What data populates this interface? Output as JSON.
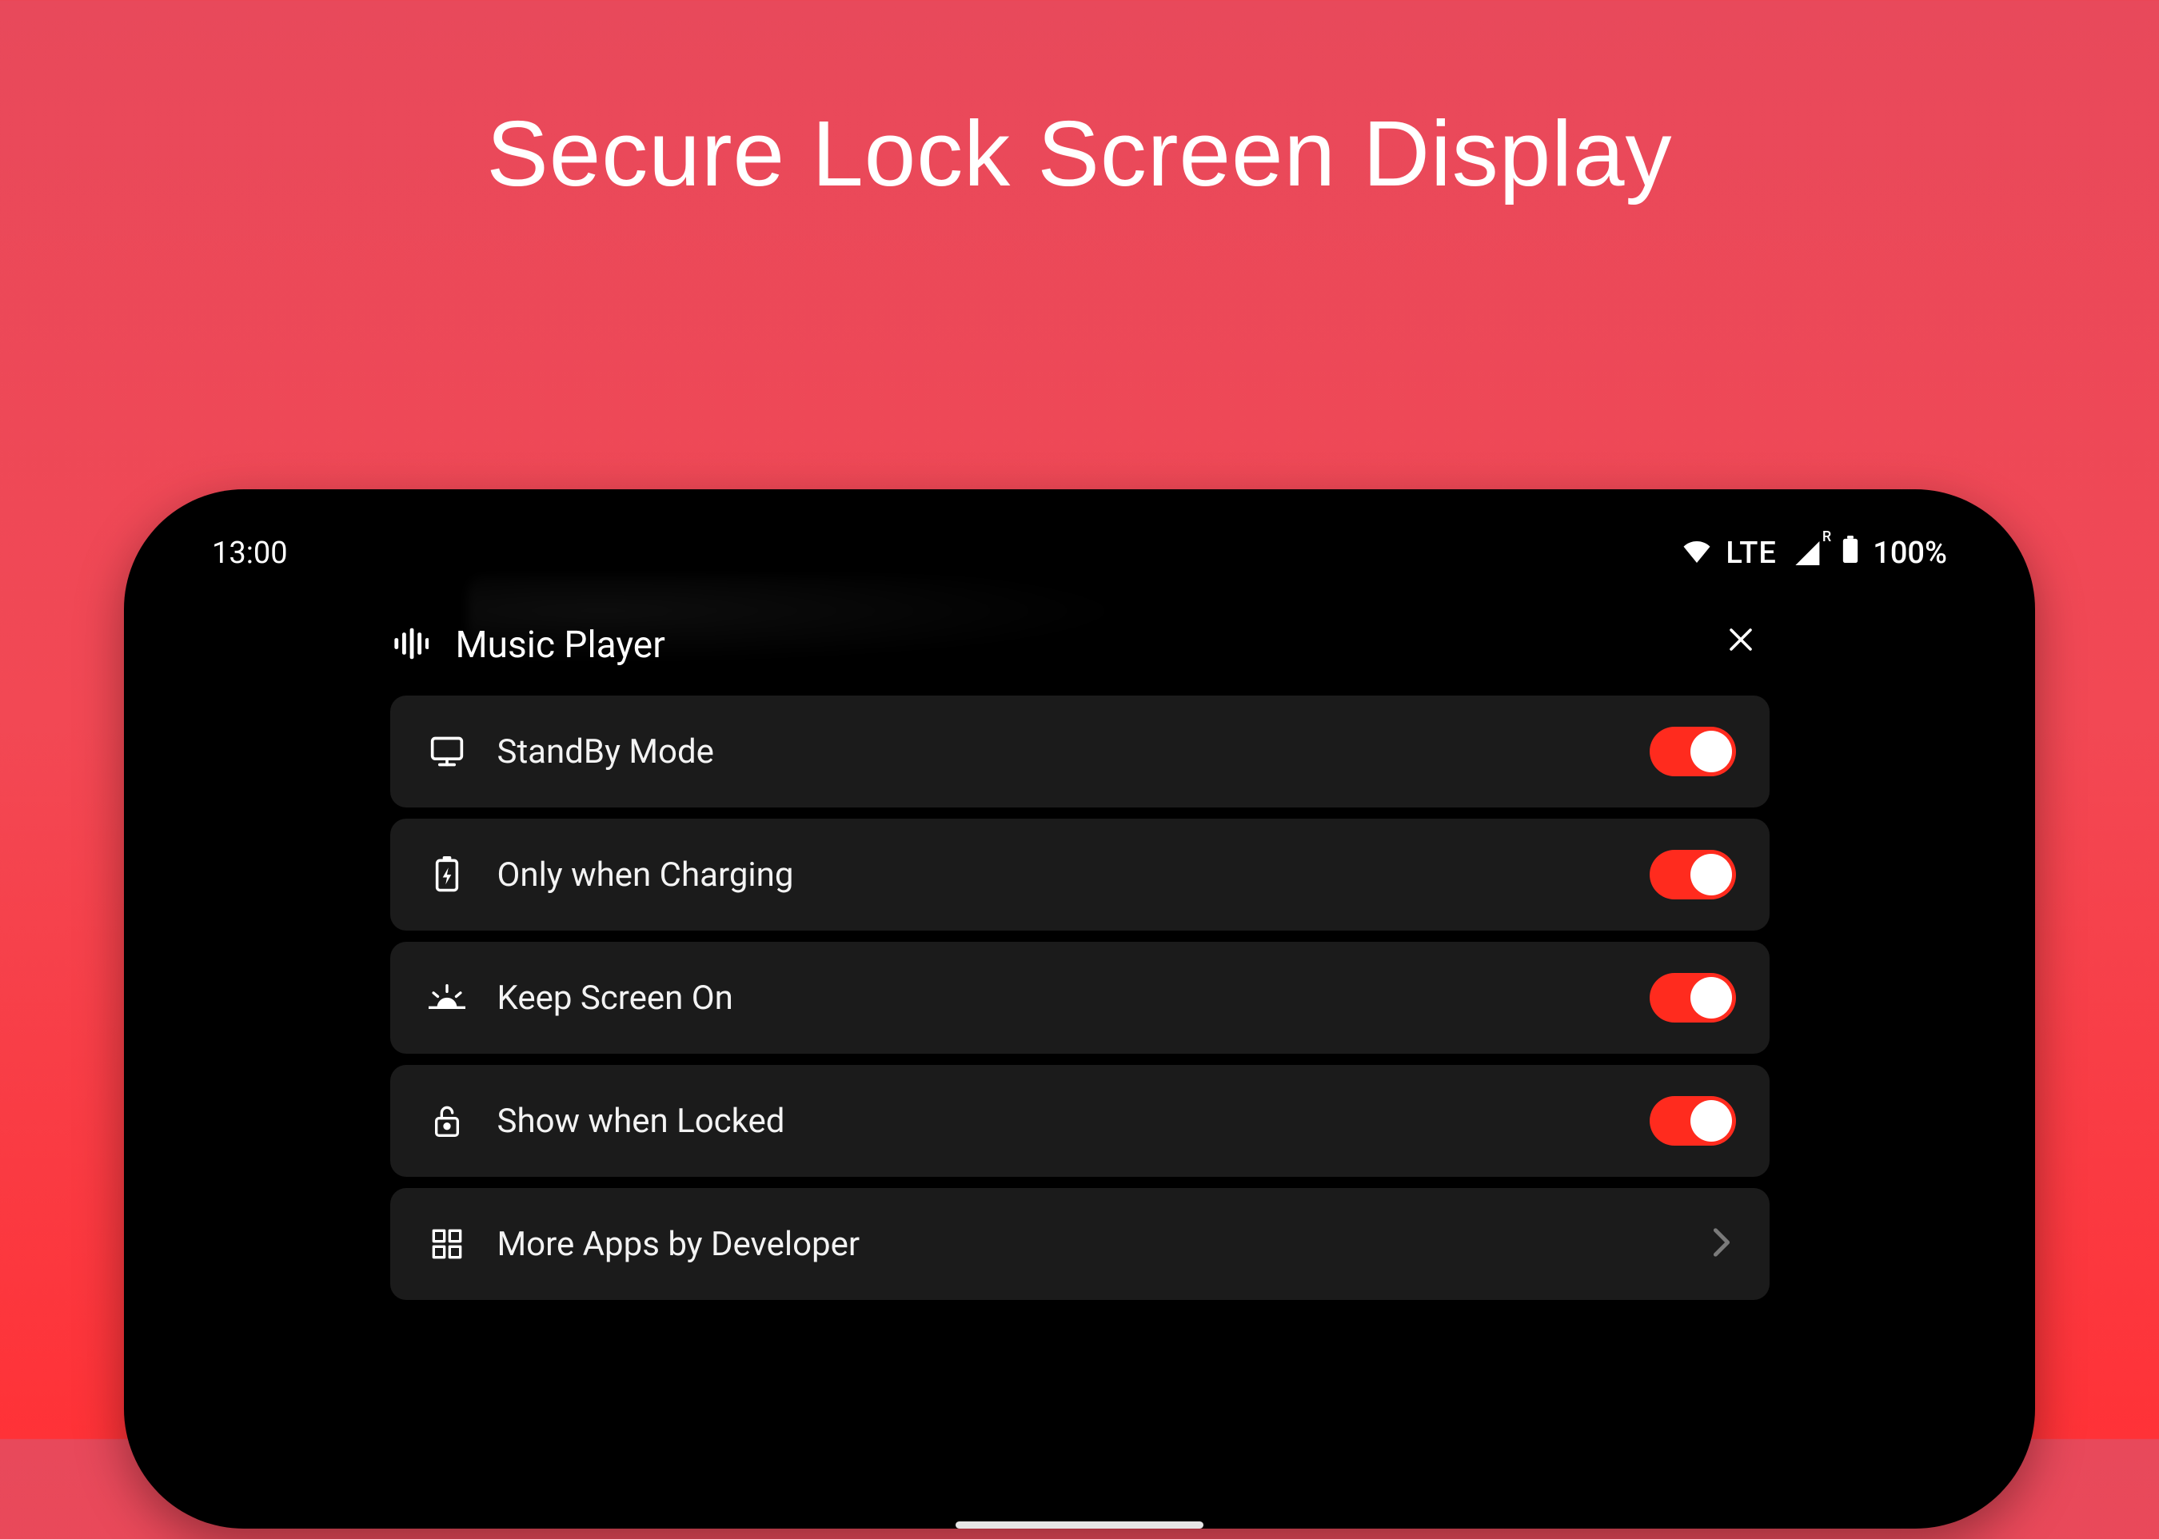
{
  "promo": {
    "title": "Secure Lock Screen Display"
  },
  "statusbar": {
    "time": "13:00",
    "network": "LTE",
    "roaming": "R",
    "battery": "100%"
  },
  "app": {
    "title": "Music Player"
  },
  "settings": [
    {
      "icon": "monitor-icon",
      "label": "StandBy Mode",
      "toggle": true
    },
    {
      "icon": "battery-charging-icon",
      "label": "Only when Charging",
      "toggle": true
    },
    {
      "icon": "brightness-icon",
      "label": "Keep Screen On",
      "toggle": true
    },
    {
      "icon": "lock-icon",
      "label": "Show when Locked",
      "toggle": true
    },
    {
      "icon": "apps-grid-icon",
      "label": "More Apps by Developer",
      "chevron": true
    }
  ],
  "colors": {
    "accent": "#ff2b1e",
    "row_bg": "#1b1b1b"
  }
}
